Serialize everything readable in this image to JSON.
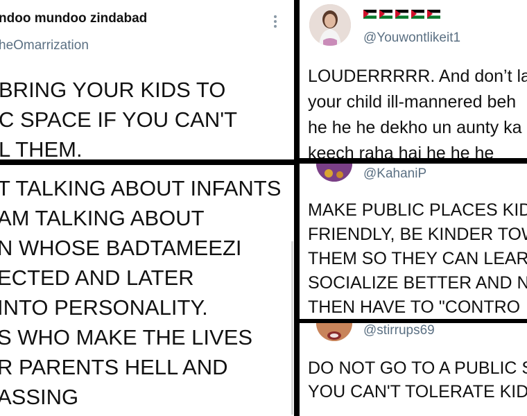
{
  "tweet_main": {
    "display_name": "ndoo mundoo zindabad",
    "handle": "heOmarrization",
    "lines": [
      "BRING YOUR KIDS TO",
      "C SPACE IF YOU CAN'T",
      "L THEM."
    ]
  },
  "tweet_main_cont": {
    "lines": [
      "T TALKING ABOUT INFANTS",
      "AM TALKING ABOUT",
      "N WHOSE BADTAMEEZI",
      "ECTED AND LATER",
      "INTO PERSONALITY.",
      "S WHO MAKE THE LIVES",
      "R PARENTS HELL AND",
      "ASSING"
    ]
  },
  "reply_1": {
    "handle": "@Youwontlikeit1",
    "lines": [
      "LOUDERRRRR. And don’t la",
      "your child ill-mannered beh",
      "he he he dekho un aunty ka",
      "keech raha hai he he he"
    ]
  },
  "reply_2": {
    "handle": "@KahaniP",
    "lines": [
      "MAKE PUBLIC PLACES KID",
      "FRIENDLY, BE KINDER TOW",
      "THEM SO THEY CAN LEAR",
      "SOCIALIZE BETTER AND N",
      "THEN HAVE TO \"CONTRO"
    ]
  },
  "reply_3": {
    "handle": "@stirrups69",
    "lines": [
      "DO NOT GO TO A PUBLIC S",
      "YOU CAN'T TOLERATE KID"
    ]
  },
  "icons": {
    "more": "more-vertical-icon",
    "flag": "palestine-flag-icon"
  }
}
